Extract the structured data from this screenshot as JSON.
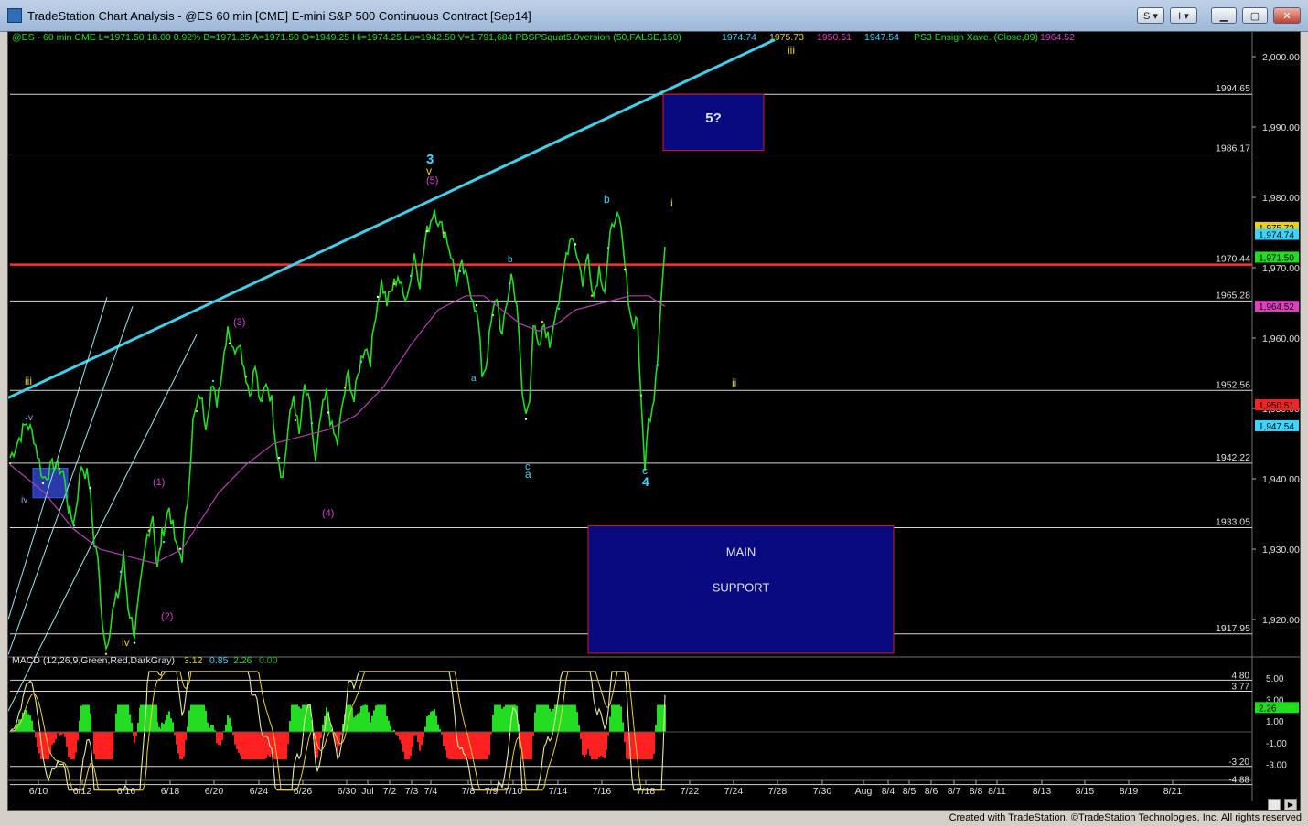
{
  "window": {
    "title": "TradeStation Chart Analysis - @ES 60 min [CME] E-mini S&P 500 Continuous Contract [Sep14]",
    "buttons": [
      "S",
      "I"
    ],
    "credit": "Created with TradeStation. ©TradeStation Technologies, Inc. All rights reserved."
  },
  "header": {
    "symbol_line": "@ES - 60 min  CME  L=1971.50  18.00  0.92%  B=1971.25  A=1971.50  O=1949.25  Hi=1974.25  Lo=1942.50  V=1,791,684  PBSPSquat5.0version (50,FALSE,150)",
    "study_values": [
      {
        "text": "1974.74",
        "color": "#3ad6ff"
      },
      {
        "text": "1975.73",
        "color": "#e8d020"
      },
      {
        "text": "1950.51",
        "color": "#e040c0"
      },
      {
        "text": "1947.54",
        "color": "#3ad6ff"
      }
    ],
    "ensign_text": "PS3 Ensign Xave. (Close,89)",
    "ensign_value": "1964.52"
  },
  "price_axis": {
    "ticks": [
      "2,000.00",
      "1,990.00",
      "1,980.00",
      "1,970.00",
      "1,960.00",
      "1,950.00",
      "1,940.00",
      "1,930.00",
      "1,920.00"
    ],
    "markers": [
      {
        "text": "1,975.73",
        "bg": "#e8d020",
        "fg": "#000000",
        "price": 1975.73
      },
      {
        "text": "1,974.74",
        "bg": "#3ad6ff",
        "fg": "#000000",
        "price": 1974.74
      },
      {
        "text": "1,971.50",
        "bg": "#22dd22",
        "fg": "#000000",
        "price": 1971.5
      },
      {
        "text": "1,964.52",
        "bg": "#e040c0",
        "fg": "#000000",
        "price": 1964.52
      },
      {
        "text": "1,950.51",
        "bg": "#ff2020",
        "fg": "#000000",
        "price": 1950.51
      },
      {
        "text": "1,947.54",
        "bg": "#3ad6ff",
        "fg": "#000000",
        "price": 1947.54
      }
    ]
  },
  "levels": [
    {
      "label": "1994.65",
      "price": 1994.65,
      "color": "#d8d8d8"
    },
    {
      "label": "1986.17",
      "price": 1986.17,
      "color": "#d8d8d8"
    },
    {
      "label": "1970.44",
      "price": 1970.44,
      "color": "#ff3030"
    },
    {
      "label": "1965.28",
      "price": 1965.28,
      "color": "#d8d8d8"
    },
    {
      "label": "1952.56",
      "price": 1952.56,
      "color": "#d8d8d8"
    },
    {
      "label": "1942.22",
      "price": 1942.22,
      "color": "#d8d8d8"
    },
    {
      "label": "1933.05",
      "price": 1933.05,
      "color": "#d8d8d8"
    },
    {
      "label": "1917.95",
      "price": 1917.95,
      "color": "#d8d8d8"
    }
  ],
  "boxes": [
    {
      "lines": [
        "5?"
      ]
    },
    {
      "lines": [
        "MAIN",
        "SUPPORT"
      ]
    }
  ],
  "wave_labels": [
    "3",
    "v",
    "(5)",
    "b",
    "i",
    "iii",
    "b",
    "a",
    "c",
    "a",
    "c",
    "4",
    "ii",
    "v",
    "iv",
    "(1)",
    "(2)",
    "(3)",
    "(4)",
    "iv"
  ],
  "macd": {
    "header": "MACD (12,26,9,Green,Red,DarkGray)",
    "values": [
      {
        "text": "3.12",
        "color": "#e8d020"
      },
      {
        "text": "0.85",
        "color": "#3ad6ff"
      },
      {
        "text": "2.26",
        "color": "#22dd22"
      },
      {
        "text": "0.00",
        "color": "#22aa22"
      }
    ],
    "ticks": [
      "5.00",
      "3.00",
      "1.00",
      "-1.00",
      "-3.00"
    ],
    "level_labels": [
      "4.80",
      "3.77",
      "-3.20",
      "-4.88"
    ],
    "current_marker": "2.26"
  },
  "date_axis": [
    "6/10",
    "6/12",
    "6/16",
    "6/18",
    "6/20",
    "6/24",
    "6/26",
    "6/30",
    "Jul",
    "7/2",
    "7/3",
    "7/4",
    "7/8",
    "7/9",
    "7/10",
    "7/14",
    "7/16",
    "7/18",
    "7/22",
    "7/24",
    "7/28",
    "7/30",
    "Aug",
    "8/4",
    "8/5",
    "8/6",
    "8/7",
    "8/8",
    "8/11",
    "8/13",
    "8/15",
    "8/19",
    "8/21"
  ],
  "colors": {
    "price": "#22dd22",
    "ensign": "#b040b0",
    "trendline": "#40d0e8",
    "box_fill": "#0a0a80",
    "box_border": "#cc2020",
    "wave_yellow": "#e8d020",
    "wave_cyan": "#3ad6ff",
    "wave_magenta": "#d040d0"
  },
  "chart_data": {
    "type": "candlestick-line",
    "x": [
      "6/10",
      "6/12",
      "6/16",
      "6/18",
      "6/20",
      "6/24",
      "6/26",
      "6/30",
      "7/2",
      "7/3",
      "7/4",
      "7/8",
      "7/9",
      "7/10",
      "7/14",
      "7/16",
      "7/18"
    ],
    "series": [
      {
        "name": "@ES",
        "values": [
          1938,
          1928,
          1921,
          1930,
          1948,
          1950,
          1944,
          1953,
          1966,
          1970,
          1974,
          1969,
          1962,
          1958,
          1970,
          1968,
          1971.5
        ]
      },
      {
        "name": "PS3 Ensign Xave. (Close,89)",
        "values": [
          1924,
          1928,
          1929,
          1932,
          1940,
          1944,
          1946,
          1950,
          1956,
          1961,
          1966,
          1967,
          1964,
          1961,
          1965,
          1966,
          1964.52
        ]
      }
    ],
    "ylim": [
      1914,
      2004
    ],
    "macd": [
      -0.5,
      -2.8,
      -3.5,
      0.8,
      2.5,
      1.0,
      -1.5,
      -0.5,
      3.0,
      2.5,
      -1.0,
      -2.0,
      -3.0,
      -1.5,
      1.8,
      -1.0,
      3.12
    ]
  }
}
